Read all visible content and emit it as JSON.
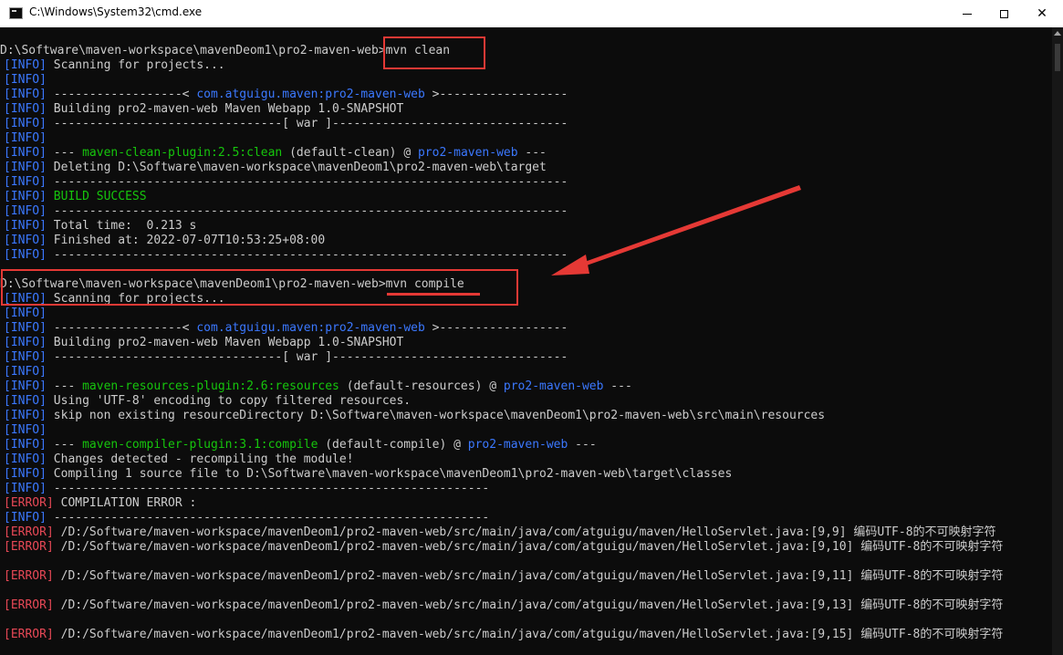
{
  "window": {
    "title": "C:\\Windows\\System32\\cmd.exe",
    "controls": {
      "minimize": "minimize",
      "maximize": "maximize",
      "close": "✕"
    }
  },
  "console": {
    "lines": [
      {
        "kind": "prompt",
        "path": "D:\\Software\\maven-workspace\\mavenDeom1\\pro2-maven-web",
        "cmd": "mvn clean"
      },
      {
        "kind": "info",
        "text": " Scanning for projects..."
      },
      {
        "kind": "info",
        "text": ""
      },
      {
        "kind": "info",
        "text": " ------------------< ",
        "artifact": "com.atguigu.maven:pro2-maven-web",
        "after": " >------------------"
      },
      {
        "kind": "info",
        "text": " Building pro2-maven-web Maven Webapp 1.0-SNAPSHOT"
      },
      {
        "kind": "info",
        "text": " --------------------------------[ war ]---------------------------------"
      },
      {
        "kind": "info",
        "text": ""
      },
      {
        "kind": "info",
        "text": " --- ",
        "plugin": "maven-clean-plugin:2.5:clean",
        "middle": " (default-clean) @ ",
        "project": "pro2-maven-web",
        "after": " ---"
      },
      {
        "kind": "info",
        "text": " Deleting D:\\Software\\maven-workspace\\mavenDeom1\\pro2-maven-web\\target"
      },
      {
        "kind": "info",
        "text": " ------------------------------------------------------------------------"
      },
      {
        "kind": "info",
        "text": " ",
        "success": "BUILD SUCCESS"
      },
      {
        "kind": "info",
        "text": " ------------------------------------------------------------------------"
      },
      {
        "kind": "info",
        "text": " Total time:  0.213 s"
      },
      {
        "kind": "info",
        "text": " Finished at: 2022-07-07T10:53:25+08:00"
      },
      {
        "kind": "info",
        "text": " ------------------------------------------------------------------------"
      },
      {
        "kind": "blank"
      },
      {
        "kind": "prompt",
        "path": "D:\\Software\\maven-workspace\\mavenDeom1\\pro2-maven-web",
        "cmd": "mvn compile"
      },
      {
        "kind": "info",
        "text": " Scanning for projects..."
      },
      {
        "kind": "info",
        "text": ""
      },
      {
        "kind": "info",
        "text": " ------------------< ",
        "artifact": "com.atguigu.maven:pro2-maven-web",
        "after": " >------------------"
      },
      {
        "kind": "info",
        "text": " Building pro2-maven-web Maven Webapp 1.0-SNAPSHOT"
      },
      {
        "kind": "info",
        "text": " --------------------------------[ war ]---------------------------------"
      },
      {
        "kind": "info",
        "text": ""
      },
      {
        "kind": "info",
        "text": " --- ",
        "plugin": "maven-resources-plugin:2.6:resources",
        "middle": " (default-resources) @ ",
        "project": "pro2-maven-web",
        "after": " ---"
      },
      {
        "kind": "info",
        "text": " Using 'UTF-8' encoding to copy filtered resources."
      },
      {
        "kind": "info",
        "text": " skip non existing resourceDirectory D:\\Software\\maven-workspace\\mavenDeom1\\pro2-maven-web\\src\\main\\resources"
      },
      {
        "kind": "info",
        "text": ""
      },
      {
        "kind": "info",
        "text": " --- ",
        "plugin": "maven-compiler-plugin:3.1:compile",
        "middle": " (default-compile) @ ",
        "project": "pro2-maven-web",
        "after": " ---"
      },
      {
        "kind": "info",
        "text": " Changes detected - recompiling the module!"
      },
      {
        "kind": "info",
        "text": " Compiling 1 source file to D:\\Software\\maven-workspace\\mavenDeom1\\pro2-maven-web\\target\\classes"
      },
      {
        "kind": "info",
        "text": " -------------------------------------------------------------"
      },
      {
        "kind": "error",
        "text": " COMPILATION ERROR :"
      },
      {
        "kind": "info",
        "text": " -------------------------------------------------------------"
      },
      {
        "kind": "error",
        "text": " /D:/Software/maven-workspace/mavenDeom1/pro2-maven-web/src/main/java/com/atguigu/maven/HelloServlet.java:[9,9] 编码UTF-8的不可映射字符"
      },
      {
        "kind": "error",
        "text": " /D:/Software/maven-workspace/mavenDeom1/pro2-maven-web/src/main/java/com/atguigu/maven/HelloServlet.java:[9,10] 编码UTF-8的不可映射字符"
      },
      {
        "kind": "blank"
      },
      {
        "kind": "error",
        "text": " /D:/Software/maven-workspace/mavenDeom1/pro2-maven-web/src/main/java/com/atguigu/maven/HelloServlet.java:[9,11] 编码UTF-8的不可映射字符"
      },
      {
        "kind": "blank"
      },
      {
        "kind": "error",
        "text": " /D:/Software/maven-workspace/mavenDeom1/pro2-maven-web/src/main/java/com/atguigu/maven/HelloServlet.java:[9,13] 编码UTF-8的不可映射字符"
      },
      {
        "kind": "blank"
      },
      {
        "kind": "error",
        "text": " /D:/Software/maven-workspace/mavenDeom1/pro2-maven-web/src/main/java/com/atguigu/maven/HelloServlet.java:[9,15] 编码UTF-8的不可映射字符"
      }
    ],
    "tags": {
      "info": "[INFO]",
      "error": "[ERROR]"
    }
  },
  "colors": {
    "background": "#0c0c0c",
    "text": "#cccccc",
    "info_tag": "#3b78ff",
    "error_tag": "#e74856",
    "plugin": "#16c60c",
    "success": "#16c60c",
    "annotation": "#e53935"
  }
}
